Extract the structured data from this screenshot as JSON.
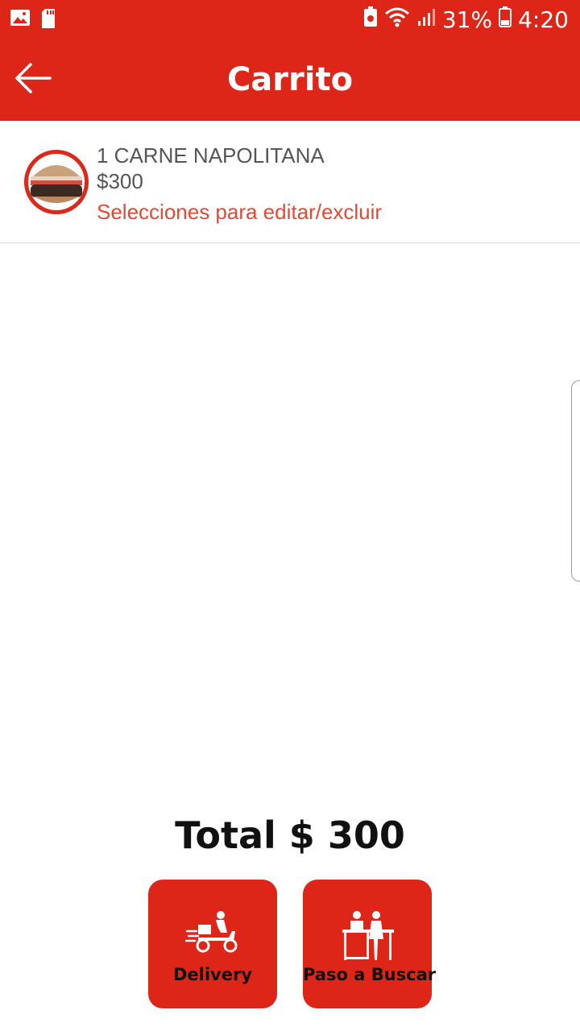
{
  "status_bar": {
    "battery_percent": "31%",
    "time": "4:20",
    "icons": [
      "image-icon",
      "sd-card-icon",
      "battery-saver-icon",
      "wifi-icon",
      "signal-icon",
      "battery-icon"
    ]
  },
  "app_bar": {
    "title": "Carrito",
    "back_icon": "arrow-left-icon"
  },
  "cart": {
    "items": [
      {
        "name": "1 CARNE NAPOLITANA",
        "price": "$300",
        "action_text": "Selecciones para editar/excluir",
        "image": "burger-thumbnail"
      }
    ]
  },
  "summary": {
    "total": "Total $ 300"
  },
  "actions": {
    "delivery_label": "Delivery",
    "delivery_icon": "scooter-icon",
    "pickup_label": "Paso a Buscar",
    "pickup_icon": "counter-icon"
  },
  "colors": {
    "primary": "#dd2518",
    "accent_text": "#e04a36",
    "item_text": "#555555"
  }
}
